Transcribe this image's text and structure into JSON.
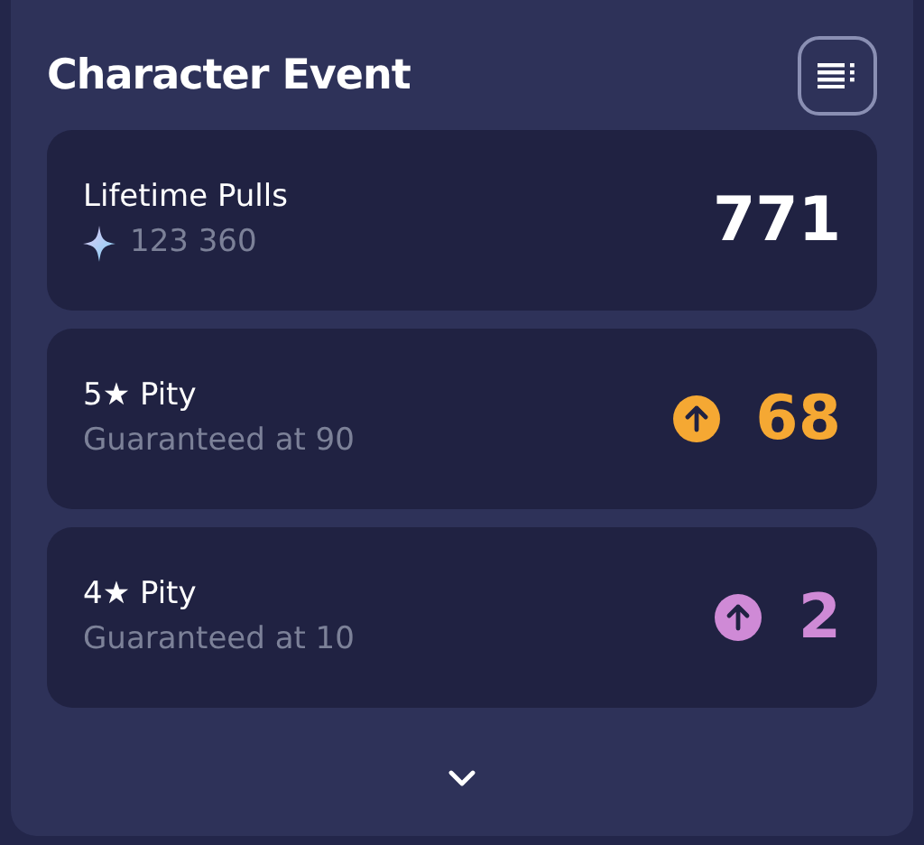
{
  "panel": {
    "title": "Character Event"
  },
  "stats": [
    {
      "kind": "total",
      "label": "Lifetime Pulls",
      "detail": "123 360",
      "value": "771"
    },
    {
      "kind": "pity",
      "label": "5★ Pity",
      "detail": "Guaranteed at 90",
      "value": "68",
      "color": "#f5a833"
    },
    {
      "kind": "pity",
      "label": "4★ Pity",
      "detail": "Guaranteed at 10",
      "value": "2",
      "color": "#cf8ad6"
    }
  ],
  "expand": {
    "expanded": false
  }
}
